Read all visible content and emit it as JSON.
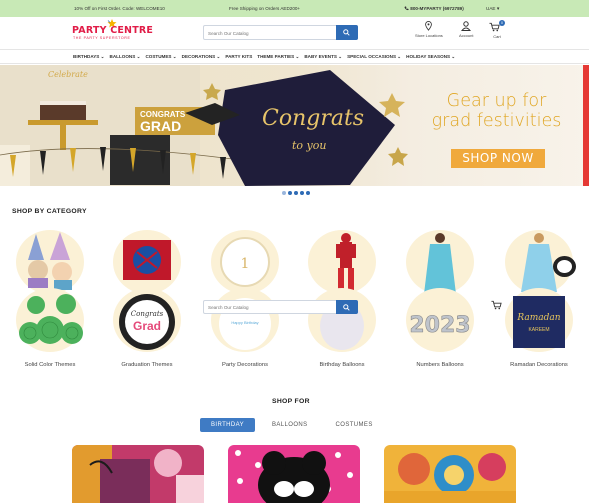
{
  "promo_bar": {
    "offer": "10% Off on First Order. Code: WELCOME10",
    "shipping": "Free Shipping on Orders AED200+",
    "phone": "800-MYPARTY (6972789)",
    "country": "UAE"
  },
  "header": {
    "logo_main": "PARTY CENTRE",
    "logo_sub": "THE PARTY SUPERSTORE",
    "search_placeholder": "Search Our Catalog",
    "store_locations": "Store Locations",
    "account": "Account",
    "cart": "Cart",
    "cart_count": "0"
  },
  "nav": {
    "items": [
      {
        "label": "BIRTHDAYS"
      },
      {
        "label": "BALLOONS"
      },
      {
        "label": "COSTUMES"
      },
      {
        "label": "DECORATIONS"
      },
      {
        "label": "PARTY KITS"
      },
      {
        "label": "THEME PARTIES"
      },
      {
        "label": "BABY EVENTS"
      },
      {
        "label": "SPECIAL OCCASIONS"
      },
      {
        "label": "HOLIDAY SEASONS"
      }
    ]
  },
  "hero": {
    "headline_line1": "Gear up for",
    "headline_line2": "grad festivities",
    "cta": "SHOP NOW",
    "balloon_script": "Congrats",
    "balloon_script2": "to you",
    "banner_word": "Celebrate",
    "grad_banner": "CONGRATS",
    "grad_banner2": "GRAD",
    "slide_count": 5,
    "active_slide": 0
  },
  "shop_by_category": {
    "title": "SHOP BY CATEGORY",
    "categories": [
      {
        "label": "Solid Color Themes"
      },
      {
        "label": "Graduation Themes"
      },
      {
        "label": "Party Decorations"
      },
      {
        "label": "Birthday Balloons"
      },
      {
        "label": "Numbers Balloons"
      },
      {
        "label": "Ramadan Decorations"
      }
    ],
    "grad_plate_top": "Congrats",
    "grad_plate_bottom": "Grad",
    "party_plate_text": "Happy Birthday",
    "numbers_text": "2023",
    "ramadan_text": "Ramadan",
    "ramadan_sub": "KAREEM"
  },
  "overlay": {
    "search_placeholder": "Search Our Catalog"
  },
  "shop_for": {
    "title": "SHOP FOR",
    "tabs": [
      {
        "label": "BIRTHDAY"
      },
      {
        "label": "BALLOONS"
      },
      {
        "label": "COSTUMES"
      }
    ],
    "active_tab": 0
  },
  "colors": {
    "promo_bg": "#c8e9b6",
    "brand_red": "#e11d48",
    "accent_blue": "#2e6bb5",
    "hero_gold": "#e0a623",
    "cta_orange": "#f0a93c"
  }
}
